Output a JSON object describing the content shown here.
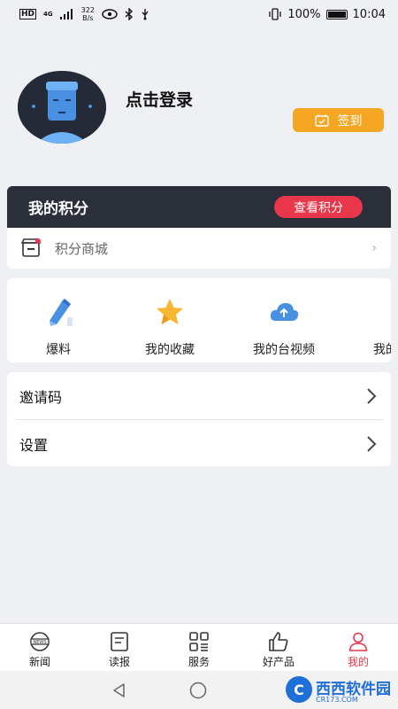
{
  "status_bar": {
    "hd": "HD",
    "net": "4G",
    "speed_value": "322",
    "speed_unit": "B/s",
    "battery": "100%",
    "time": "10:04"
  },
  "profile": {
    "login_text": "点击登录",
    "checkin_label": "签到"
  },
  "points": {
    "title": "我的积分",
    "view_label": "查看积分",
    "mall_label": "积分商城"
  },
  "features": [
    {
      "label": "爆料",
      "icon": "pencil-icon"
    },
    {
      "label": "我的收藏",
      "icon": "star-icon"
    },
    {
      "label": "我的台视频",
      "icon": "cloud-upload-icon"
    },
    {
      "label": "我的",
      "icon": "folder-icon"
    }
  ],
  "menu": [
    {
      "label": "邀请码"
    },
    {
      "label": "设置"
    }
  ],
  "bottom_nav": [
    {
      "label": "新闻",
      "icon": "globe-news-icon"
    },
    {
      "label": "读报",
      "icon": "newspaper-icon"
    },
    {
      "label": "服务",
      "icon": "grid-icon"
    },
    {
      "label": "好产品",
      "icon": "thumbs-up-icon"
    },
    {
      "label": "我的",
      "icon": "user-icon",
      "active": true
    }
  ],
  "watermark": {
    "logo": "C",
    "text": "西西软件园",
    "sub": "CR173.COM"
  },
  "colors": {
    "accent_red": "#e8364a",
    "checkin_orange": "#f5a623",
    "points_header_dark": "#2b2f3a"
  }
}
